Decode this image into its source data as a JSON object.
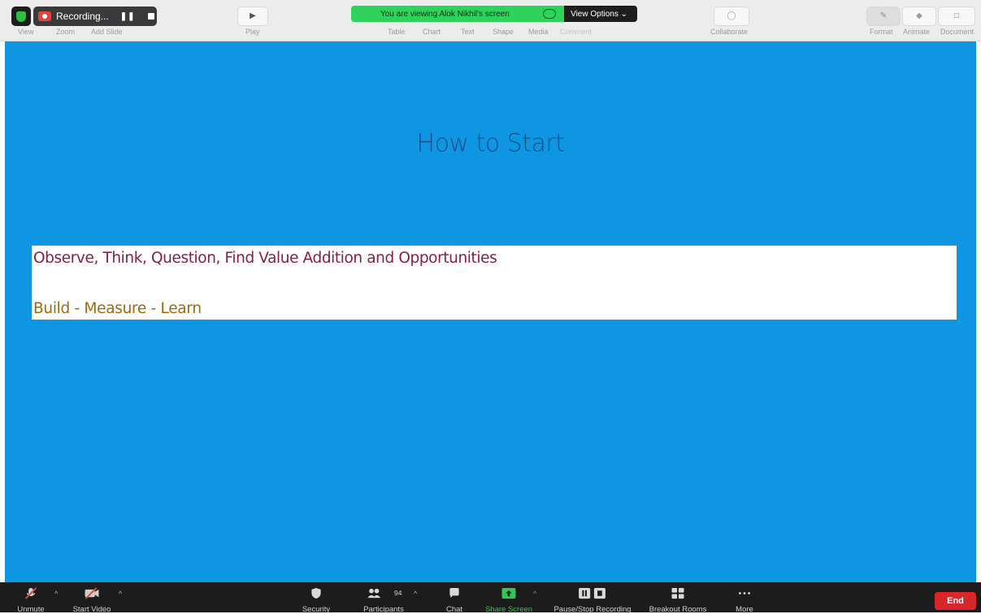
{
  "zoom_recording": {
    "label": "Recording..."
  },
  "viewing_banner": {
    "text": "You are viewing Alok Nikhil's screen",
    "options_label": "View Options ⌄"
  },
  "keynote_toolbar": {
    "left": [
      "View",
      "Zoom",
      "Add Slide"
    ],
    "play": "Play",
    "insert": [
      "Table",
      "Chart",
      "Text",
      "Shape",
      "Media",
      "Comment"
    ],
    "collaborate": "Collaborate",
    "right": [
      "Format",
      "Animate",
      "Document"
    ]
  },
  "slide": {
    "title": "How to Start",
    "line1": "Observe, Think, Question, Find Value Addition and Opportunities",
    "line2": "Build - Measure - Learn",
    "background_color": "#0e96e3"
  },
  "zoom_toolbar": {
    "unmute": "Unmute",
    "start_video": "Start Video",
    "security": "Security",
    "participants": "Participants",
    "participants_count": "94",
    "chat": "Chat",
    "share_screen": "Share Screen",
    "pause_stop": "Pause/Stop Recording",
    "breakout": "Breakout Rooms",
    "more": "More",
    "end": "End"
  }
}
